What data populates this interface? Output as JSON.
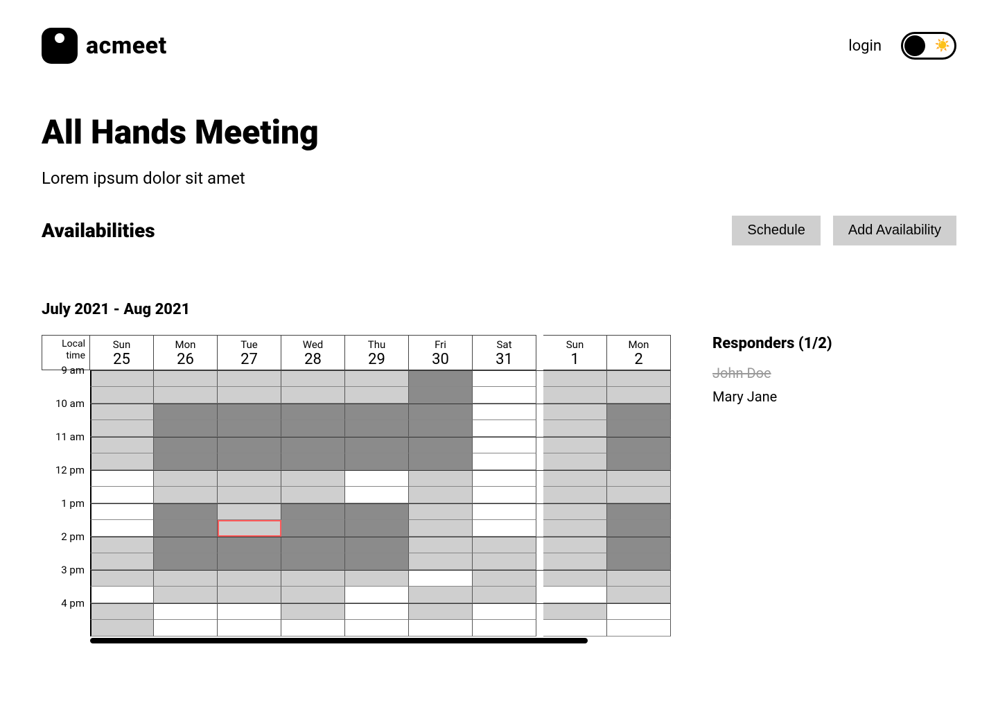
{
  "header": {
    "brand": "acmeet",
    "login": "login"
  },
  "meeting": {
    "title": "All Hands Meeting",
    "description": "Lorem ipsum dolor sit amet"
  },
  "availabilities": {
    "heading": "Availabilities",
    "schedule_btn": "Schedule",
    "add_btn": "Add Availability",
    "date_range": "July 2021 - Aug  2021"
  },
  "calendar": {
    "time_col_label_line1": "Local",
    "time_col_label_line2": "time",
    "days": [
      {
        "dow": "Sun",
        "dom": "25"
      },
      {
        "dow": "Mon",
        "dom": "26"
      },
      {
        "dow": "Tue",
        "dom": "27"
      },
      {
        "dow": "Wed",
        "dom": "28"
      },
      {
        "dow": "Thu",
        "dom": "29"
      },
      {
        "dow": "Fri",
        "dom": "30"
      },
      {
        "dow": "Sat",
        "dom": "31"
      },
      {
        "dow": "Sun",
        "dom": "1"
      },
      {
        "dow": "Mon",
        "dom": "2"
      }
    ],
    "hours": [
      "9 am",
      "10 am",
      "11 am",
      "12 pm",
      "1 pm",
      "2 pm",
      "3 pm",
      "4 pm"
    ],
    "slot_levels": [
      [
        1,
        1,
        1,
        1,
        1,
        2,
        0,
        1,
        1
      ],
      [
        1,
        1,
        1,
        1,
        1,
        2,
        0,
        1,
        1
      ],
      [
        1,
        2,
        2,
        2,
        2,
        2,
        0,
        1,
        2
      ],
      [
        1,
        2,
        2,
        2,
        2,
        2,
        0,
        1,
        2
      ],
      [
        1,
        2,
        2,
        2,
        2,
        2,
        0,
        1,
        2
      ],
      [
        1,
        2,
        2,
        2,
        2,
        2,
        0,
        1,
        2
      ],
      [
        0,
        1,
        1,
        1,
        0,
        1,
        0,
        1,
        1
      ],
      [
        0,
        1,
        1,
        1,
        0,
        1,
        0,
        1,
        1
      ],
      [
        0,
        2,
        1,
        2,
        2,
        1,
        0,
        1,
        2
      ],
      [
        0,
        2,
        1,
        2,
        2,
        1,
        0,
        1,
        2
      ],
      [
        1,
        2,
        2,
        2,
        2,
        1,
        1,
        1,
        2
      ],
      [
        1,
        2,
        2,
        2,
        2,
        1,
        1,
        1,
        2
      ],
      [
        1,
        1,
        1,
        1,
        1,
        0,
        1,
        1,
        1
      ],
      [
        0,
        1,
        1,
        1,
        0,
        1,
        1,
        0,
        1
      ],
      [
        1,
        0,
        0,
        1,
        0,
        1,
        0,
        1,
        0
      ],
      [
        1,
        0,
        0,
        0,
        0,
        0,
        0,
        0,
        0
      ]
    ],
    "selected": {
      "row": 9,
      "col": 2
    }
  },
  "responders": {
    "heading": "Responders  (1/2)",
    "people": [
      {
        "name": "John Doe",
        "struck": true
      },
      {
        "name": "Mary Jane",
        "struck": false
      }
    ]
  }
}
